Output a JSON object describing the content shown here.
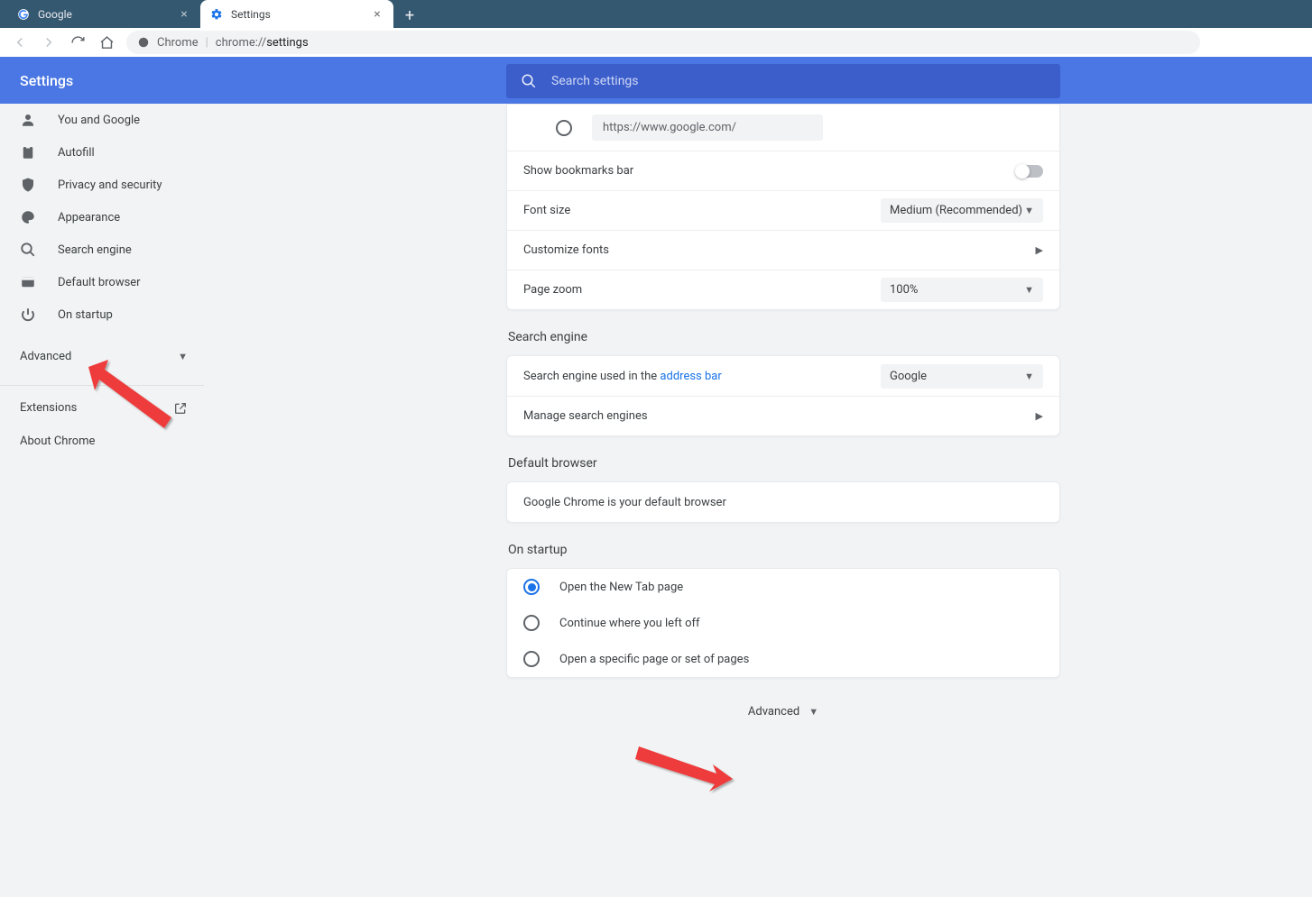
{
  "tabs": [
    {
      "title": "Google"
    },
    {
      "title": "Settings"
    }
  ],
  "omnibox": {
    "context": "Chrome",
    "prefix": "chrome://",
    "path": "settings"
  },
  "header": {
    "title": "Settings"
  },
  "search": {
    "placeholder": "Search settings"
  },
  "sidebar": {
    "items": [
      {
        "label": "You and Google"
      },
      {
        "label": "Autofill"
      },
      {
        "label": "Privacy and security"
      },
      {
        "label": "Appearance"
      },
      {
        "label": "Search engine"
      },
      {
        "label": "Default browser"
      },
      {
        "label": "On startup"
      }
    ],
    "advanced": "Advanced",
    "extensions": "Extensions",
    "about": "About Chrome"
  },
  "appearance": {
    "homepage_url": "https://www.google.com/",
    "bookmarks_bar": "Show bookmarks bar",
    "font_size_label": "Font size",
    "font_size_value": "Medium (Recommended)",
    "customize_fonts": "Customize fonts",
    "page_zoom_label": "Page zoom",
    "page_zoom_value": "100%"
  },
  "search_engine": {
    "title": "Search engine",
    "used_in_prefix": "Search engine used in the ",
    "address_bar_link": "address bar",
    "value": "Google",
    "manage": "Manage search engines"
  },
  "default_browser": {
    "title": "Default browser",
    "message": "Google Chrome is your default browser"
  },
  "on_startup": {
    "title": "On startup",
    "options": [
      "Open the New Tab page",
      "Continue where you left off",
      "Open a specific page or set of pages"
    ]
  },
  "footer": {
    "advanced": "Advanced"
  }
}
